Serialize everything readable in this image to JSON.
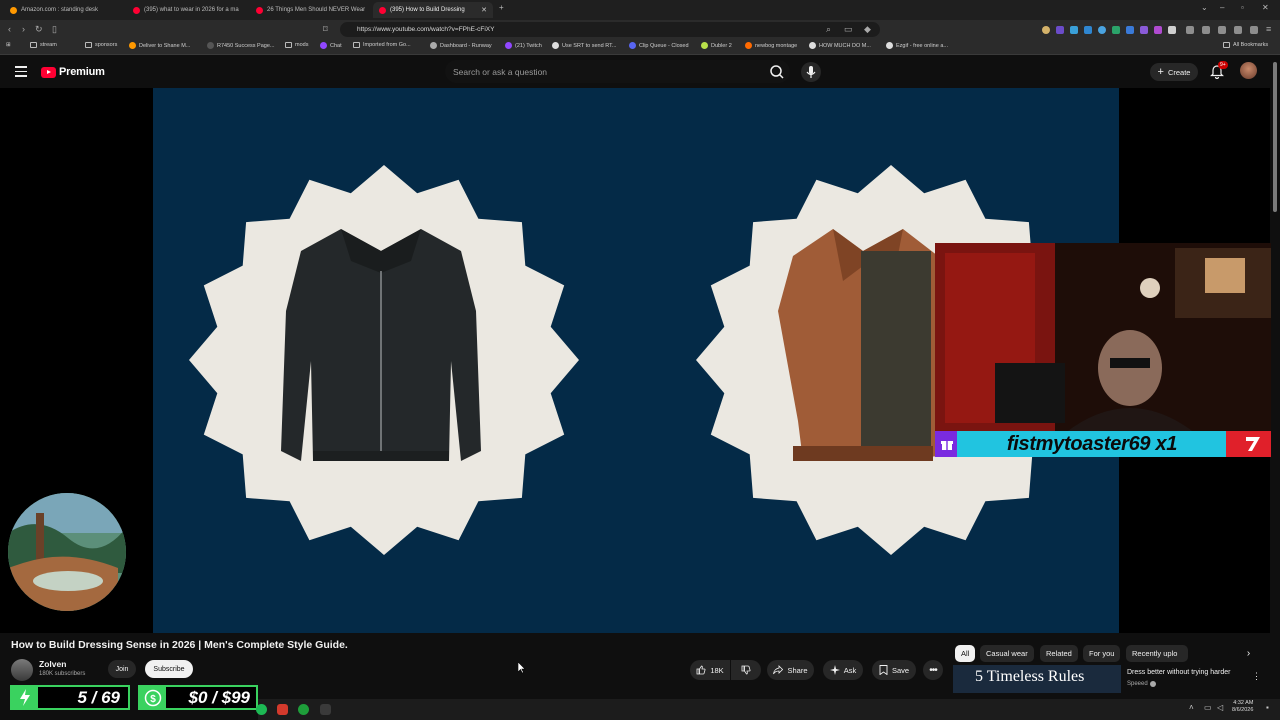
{
  "browser": {
    "tabs": [
      {
        "title": "Amazon.com : standing desk",
        "favicon_color": "#ff9900",
        "active": false
      },
      {
        "title": "(395) what to wear in 2026 for a ma",
        "favicon_color": "#ff0033",
        "active": false
      },
      {
        "title": "26 Things Men Should NEVER Wear",
        "favicon_color": "#ff0033",
        "active": false
      },
      {
        "title": "(395) How to Build Dressing",
        "favicon_color": "#ff0033",
        "active": true
      }
    ],
    "url": "https://www.youtube.com/watch?v=FPhE-cFiXY",
    "bookmarks": [
      "stream",
      "sponsors",
      "Deliver to Shane M...",
      "R7450 Success Page...",
      "mods",
      "Chat",
      "Imported from Go...",
      "Dashboard - Runway",
      "(21) Twitch",
      "Use SRT to send RT...",
      "Clip Queue - Closed",
      "Dubler 2",
      "newbog montage",
      "HOW MUCH DO M...",
      "Ezgif - free online a..."
    ],
    "all_bookmarks_label": "All Bookmarks"
  },
  "youtube": {
    "logo_text": "Premium",
    "search_placeholder": "Search or ask a question",
    "create_label": "Create",
    "notification_count": "9+"
  },
  "overlay": {
    "webcam_banner": "fistmytoaster69 x1",
    "goal_subs": "5 / 69",
    "goal_money": "$0 / $99"
  },
  "video": {
    "title": "How to Build Dressing Sense in 2026 | Men's Complete Style Guide.",
    "channel_name": "Zolven",
    "channel_subs": "180K subscribers",
    "join_label": "Join",
    "subscribe_label": "Subscribe",
    "like_count": "18K",
    "share_label": "Share",
    "ask_label": "Ask",
    "save_label": "Save"
  },
  "related": {
    "chips": [
      "All",
      "Casual wear",
      "Related",
      "For you",
      "Recently uplo"
    ],
    "active_chip": "All",
    "thumb_text": "5 Timeless Rules",
    "rec_title": "Dress better without trying harder",
    "rec_channel": "Speeed"
  },
  "taskbar": {
    "time": "4:32 AM",
    "date": "8/6/2026"
  }
}
